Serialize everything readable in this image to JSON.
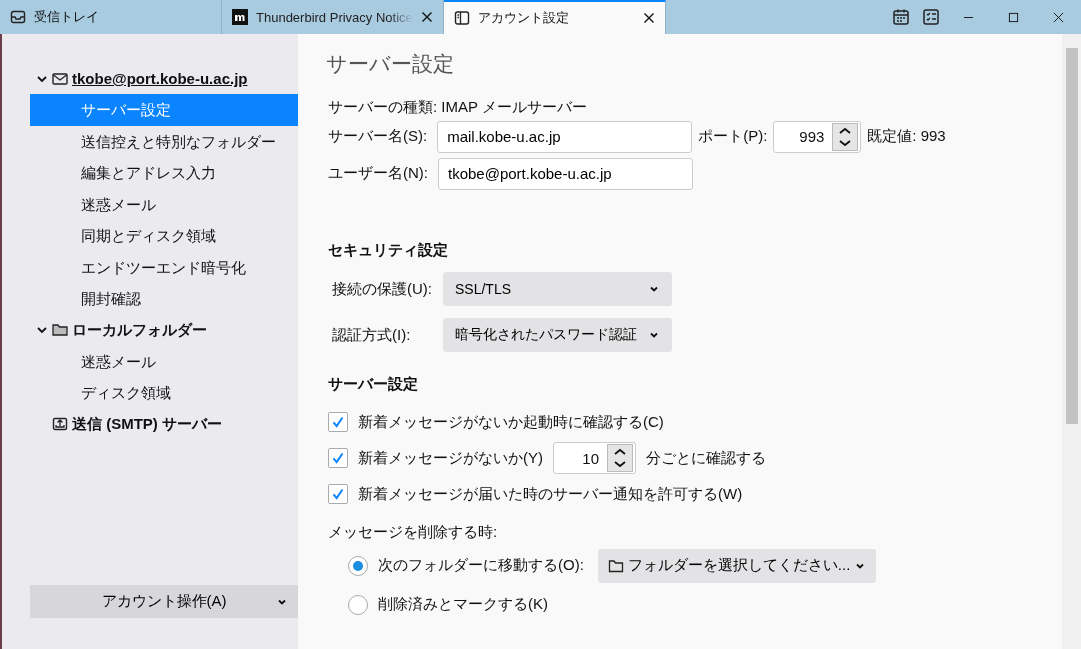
{
  "tabs": [
    {
      "kind": "mail",
      "label": "受信トレイ",
      "selected": false
    },
    {
      "kind": "web",
      "label": "Thunderbird Privacy Notice",
      "selected": false
    },
    {
      "kind": "settings",
      "label": "アカウント設定",
      "selected": true
    }
  ],
  "sidebar": {
    "accounts": [
      {
        "kind": "mail",
        "label": "tkobe@port.kobe-u.ac.jp",
        "expanded": true,
        "children": [
          {
            "label": "サーバー設定",
            "selected": true
          },
          {
            "label": "送信控えと特別なフォルダー",
            "selected": false
          },
          {
            "label": "編集とアドレス入力",
            "selected": false
          },
          {
            "label": "迷惑メール",
            "selected": false
          },
          {
            "label": "同期とディスク領域",
            "selected": false
          },
          {
            "label": "エンドツーエンド暗号化",
            "selected": false
          },
          {
            "label": "開封確認",
            "selected": false
          }
        ]
      },
      {
        "kind": "folder",
        "label": "ローカルフォルダー",
        "expanded": true,
        "children": [
          {
            "label": "迷惑メール",
            "selected": false
          },
          {
            "label": "ディスク領域",
            "selected": false
          }
        ]
      },
      {
        "kind": "smtp",
        "label": "送信 (SMTP) サーバー",
        "expanded": false
      }
    ],
    "account_actions": "アカウント操作(A)"
  },
  "main": {
    "title": "サーバー設定",
    "server_type": "サーバーの種類: IMAP メールサーバー",
    "server_name": {
      "label": "サーバー名(S):",
      "value": "mail.kobe-u.ac.jp"
    },
    "port": {
      "label": "ポート(P):",
      "value": "993"
    },
    "port_default": "既定値: 993",
    "user_name": {
      "label": "ユーザー名(N):",
      "value": "tkobe@port.kobe-u.ac.jp"
    },
    "security": {
      "heading": "セキュリティ設定",
      "fields": [
        {
          "label": "接続の保護(U):",
          "value": "SSL/TLS"
        },
        {
          "label": "認証方式(I):",
          "value": "暗号化されたパスワード認証"
        }
      ]
    },
    "server_settings": {
      "heading": "サーバー設定",
      "checks": [
        {
          "kind": "plain",
          "label": "新着メッセージがないか起動時に確認する(C)",
          "checked": true
        },
        {
          "kind": "interval",
          "label": "新着メッセージがないか(Y)",
          "checked": true,
          "value": "10",
          "suffix": "分ごとに確認する"
        },
        {
          "kind": "plain",
          "label": "新着メッセージが届いた時のサーバー通知を許可する(W)",
          "checked": true
        }
      ]
    },
    "delete": {
      "label": "メッセージを削除する時:",
      "options": [
        {
          "label": "次のフォルダーに移動する(O):",
          "selected": true,
          "folder_select": "フォルダーを選択してください..."
        },
        {
          "label": "削除済みとマークする(K)",
          "selected": false
        }
      ]
    }
  }
}
